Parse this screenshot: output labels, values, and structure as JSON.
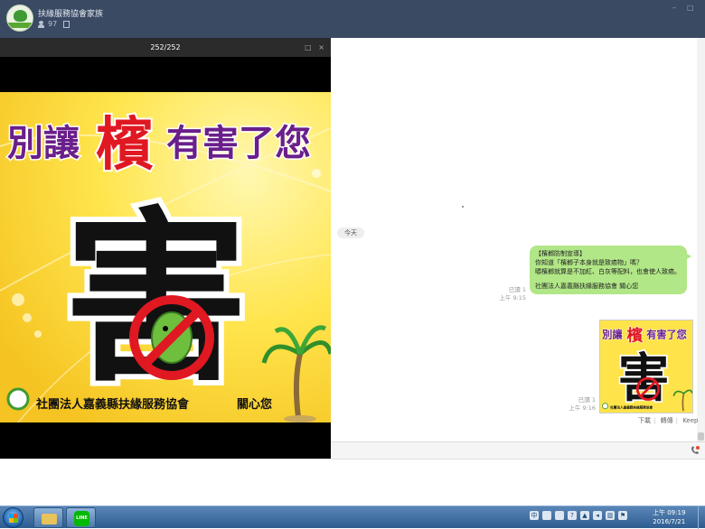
{
  "header": {
    "group_name": "扶緣服務協會家族",
    "member_count": "97",
    "window_controls": [
      "–",
      "□"
    ]
  },
  "viewer": {
    "counter": "252/252",
    "controls": [
      "□",
      "×"
    ]
  },
  "poster": {
    "headline_left": "別讓",
    "headline_big": "檳",
    "headline_right": "有害了您",
    "main_char": "害",
    "footer_org": "社團法人嘉義縣扶緣服務協會",
    "footer_care": "關心您"
  },
  "chat": {
    "date_label": "今天",
    "message1": {
      "read": "已讀 1",
      "time": "上午 9:15",
      "lines": [
        "【檳榔防制宣導】",
        "你知道「檳榔子本身就是致癌物」嗎？",
        "嚼檳榔就算是不加紅、白灰等配料，也會使人致癌。",
        "",
        "社團法人嘉義縣扶緣服務協會 關心您"
      ]
    },
    "message2": {
      "read": "已讀 1",
      "time": "上午 9:16"
    },
    "actions": [
      "下載",
      "轉傳",
      "Keep"
    ]
  },
  "taskbar": {
    "line_label": "LINE",
    "ime": "中",
    "clock_time": "上午 09:19",
    "clock_date": "2016/7/21"
  },
  "colors": {
    "header_bg": "#3b4a63",
    "bubble_green": "#b1e787",
    "poster_yellow": "#ffe34a",
    "headline_purple": "#6a1f8a",
    "headline_red": "#e01822"
  }
}
